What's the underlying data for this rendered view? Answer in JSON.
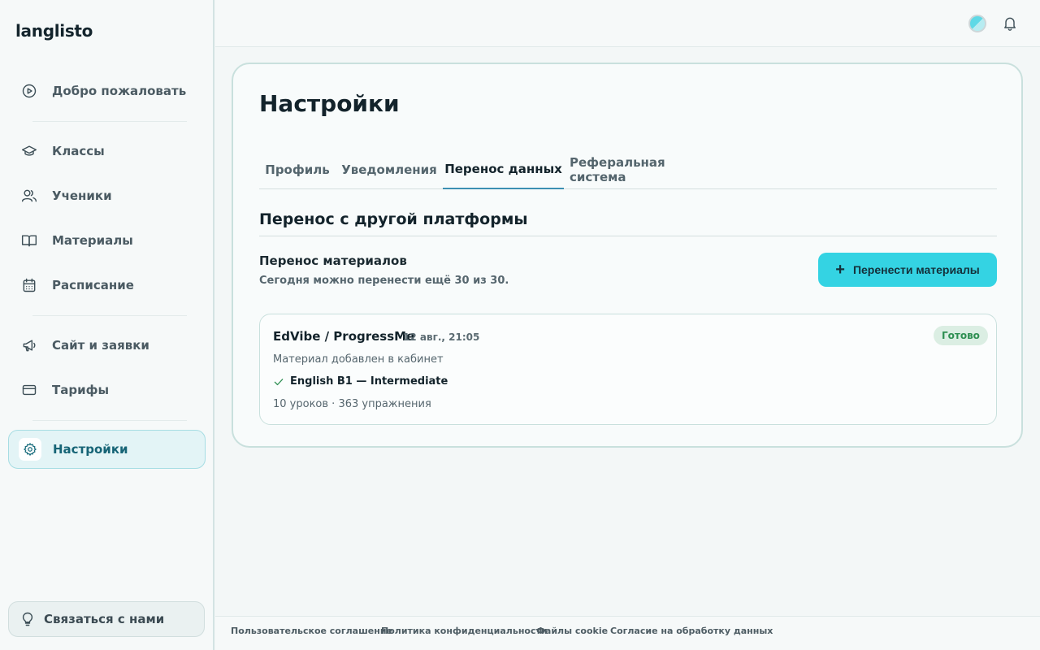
{
  "app": {
    "logo": "langlisto"
  },
  "sidebar": {
    "items": [
      {
        "label": "Добро пожаловать",
        "icon": "play-circle-icon"
      },
      {
        "label": "Классы",
        "icon": "graduation-cap-icon"
      },
      {
        "label": "Ученики",
        "icon": "users-icon"
      },
      {
        "label": "Материалы",
        "icon": "book-open-icon"
      },
      {
        "label": "Расписание",
        "icon": "calendar-icon"
      },
      {
        "label": "Сайт и заявки",
        "icon": "megaphone-icon"
      },
      {
        "label": "Тарифы",
        "icon": "credit-card-icon"
      },
      {
        "label": "Настройки",
        "icon": "gear-icon",
        "active": true
      }
    ],
    "contact_label": "Связаться с нами"
  },
  "page": {
    "title": "Настройки",
    "tabs": [
      {
        "label": "Профиль"
      },
      {
        "label": "Уведомления"
      },
      {
        "label": "Перенос данных",
        "active": true
      },
      {
        "label": "Реферальная система"
      }
    ],
    "section_title": "Перенос с другой платформы",
    "transfer": {
      "title": "Перенос материалов",
      "description": "Сегодня можно перенести ещё 30 из 30.",
      "button_label": "Перенести материалы"
    },
    "import_item": {
      "name": "EdVibe / ProgressMe",
      "date": "12 авг., 21:05",
      "status": "Готово",
      "message": "Материал добавлен в кабинет",
      "course": "English B1 — Intermediate",
      "stats": "10 уроков · 363 упражнения"
    }
  },
  "footer": {
    "links": [
      "Пользовательское соглашение",
      "Политика конфиденциальности",
      "Файлы cookie",
      "Согласие на обработку данных"
    ]
  },
  "colors": {
    "accent": "#34d3e3",
    "active_nav_bg": "#e3f4f6",
    "status_success": "#2e8f52"
  }
}
